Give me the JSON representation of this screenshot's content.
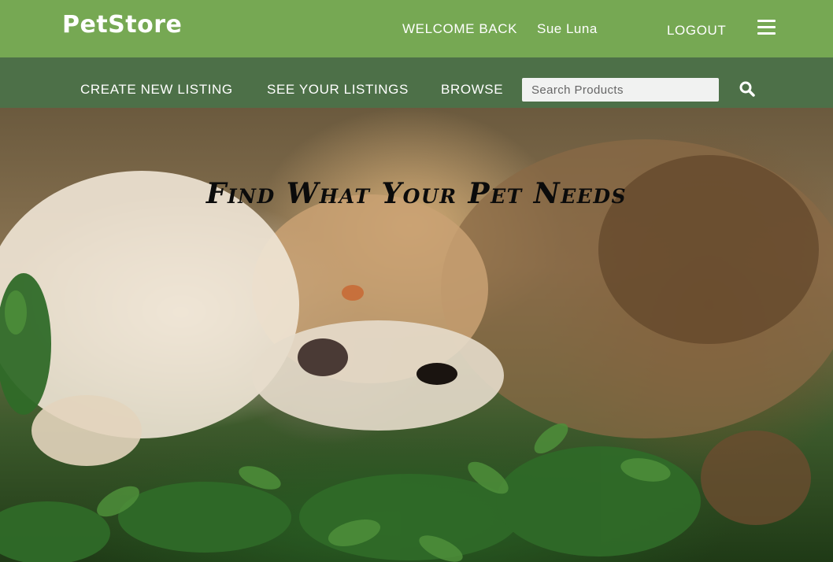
{
  "header": {
    "logo": "PetStore",
    "welcome_label": "WELCOME BACK",
    "username": "Sue Luna",
    "logout_label": "LOGOUT",
    "menu_icon": "hamburger-menu-icon"
  },
  "nav": {
    "items": [
      {
        "label": "CREATE NEW LISTING"
      },
      {
        "label": "SEE YOUR LISTINGS"
      },
      {
        "label": "BROWSE"
      }
    ],
    "search": {
      "placeholder": "Search Products",
      "value": "",
      "icon": "search-icon"
    }
  },
  "hero": {
    "title": "Find What Your Pet Needs"
  },
  "colors": {
    "header_bg": "#76a853",
    "nav_bg": "#4d7048",
    "text_light": "#ffffff"
  }
}
